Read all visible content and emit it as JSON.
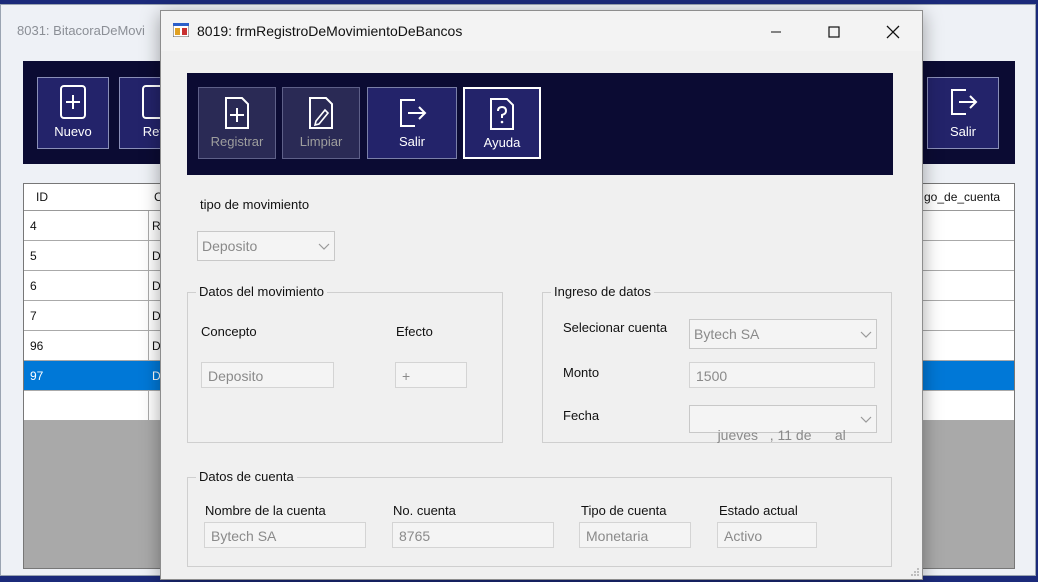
{
  "background_window": {
    "title": "8031: BitacoraDeMovi",
    "toolbar": [
      {
        "label": "Nuevo",
        "icon": "plus-box-icon"
      },
      {
        "label": "Refr",
        "icon": "refresh-icon"
      },
      {
        "label": "Salir",
        "icon": "exit-icon"
      }
    ],
    "grid": {
      "headers": [
        "ID",
        "C",
        "go_de_cuenta"
      ],
      "rows": [
        {
          "id": "4",
          "c": "R"
        },
        {
          "id": "5",
          "c": "D"
        },
        {
          "id": "6",
          "c": "D"
        },
        {
          "id": "7",
          "c": "D"
        },
        {
          "id": "96",
          "c": "D"
        },
        {
          "id": "97",
          "c": "D"
        }
      ],
      "selected_row_id": "97"
    }
  },
  "dialog": {
    "title": "8019: frmRegistroDeMovimientoDeBancos",
    "toolbar": {
      "registrar": "Registrar",
      "limpiar": "Limpiar",
      "salir": "Salir",
      "ayuda": "Ayuda"
    },
    "tipo_movimiento": {
      "label": "tipo de movimiento",
      "value": "Deposito"
    },
    "datos_movimiento": {
      "title": "Datos del movimiento",
      "concepto_label": "Concepto",
      "concepto_value": "Deposito",
      "efecto_label": "Efecto",
      "efecto_value": "+"
    },
    "ingreso_datos": {
      "title": "Ingreso de datos",
      "cuenta_label": "Selecionar cuenta",
      "cuenta_value": "Bytech SA",
      "monto_label": "Monto",
      "monto_value": "1500",
      "fecha_label": "Fecha",
      "fecha_value": "jueves   , 11 de      al"
    },
    "datos_cuenta": {
      "title": "Datos de cuenta",
      "nombre_label": "Nombre de la cuenta",
      "nombre_value": "Bytech SA",
      "no_cuenta_label": "No. cuenta",
      "no_cuenta_value": "8765",
      "tipo_label": "Tipo de cuenta",
      "tipo_value": "Monetaria",
      "estado_label": "Estado actual",
      "estado_value": "Activo"
    }
  },
  "colors": {
    "toolbar_bg": "#0b0b33",
    "button_bg": "#23236a",
    "selection": "#0078d7",
    "desktop": "#1b2a7a"
  }
}
